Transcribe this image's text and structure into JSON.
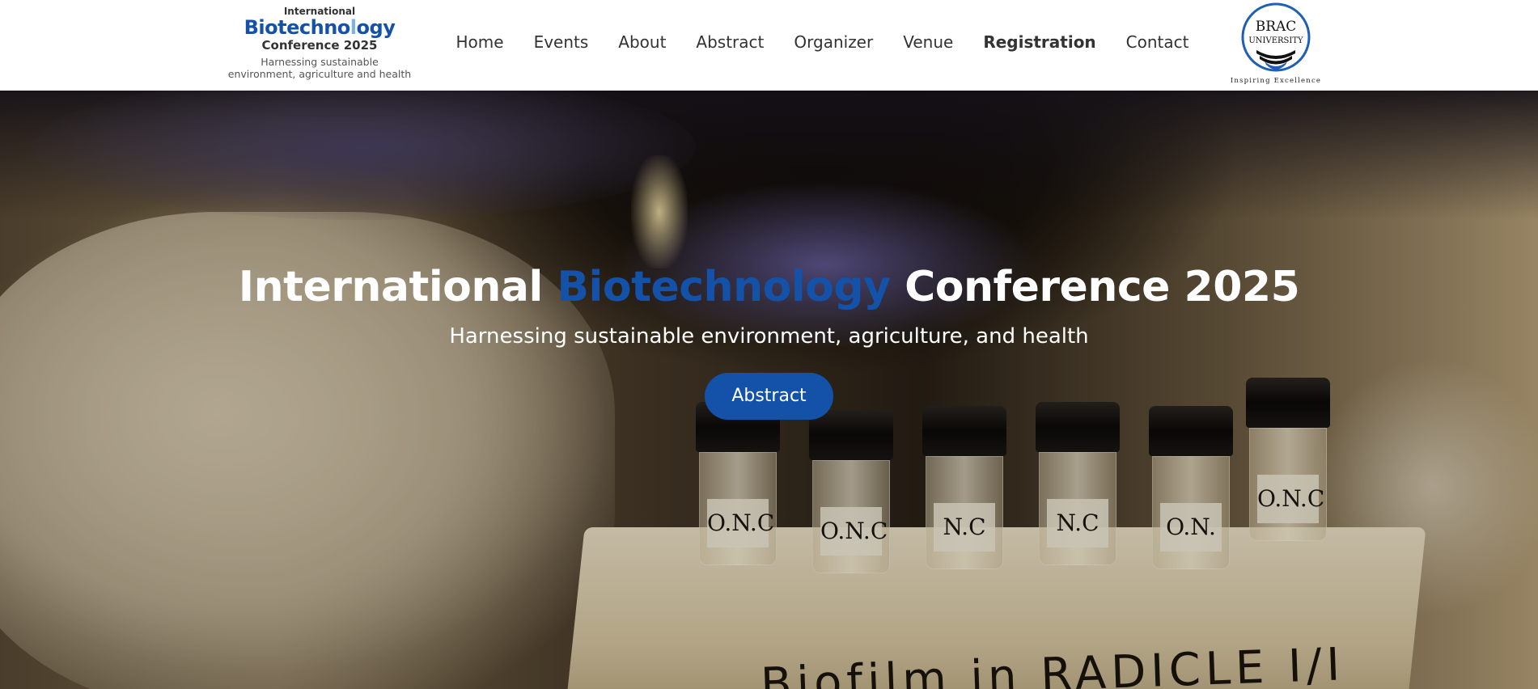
{
  "logo": {
    "top_line": "International",
    "main_before": "Biotechno",
    "main_helix": "l",
    "main_after": "ogy",
    "conference": "Conference 2025",
    "tagline_1": "Harnessing sustainable",
    "tagline_2": "environment, agriculture and health"
  },
  "nav": {
    "items": [
      {
        "label": "Home"
      },
      {
        "label": "Events"
      },
      {
        "label": "About"
      },
      {
        "label": "Abstract"
      },
      {
        "label": "Organizer"
      },
      {
        "label": "Venue"
      },
      {
        "label": "Registration"
      },
      {
        "label": "Contact"
      }
    ],
    "active": "Registration"
  },
  "partner_logo": {
    "name_line1": "BRAC",
    "name_line2": "UNIVERSITY",
    "tagline": "Inspiring Excellence"
  },
  "hero": {
    "title_before": "International ",
    "title_accent": "Biotechnology",
    "title_after": " Conference 2025",
    "subtitle": "Harnessing sustainable environment, agriculture, and health",
    "button_label": "Abstract",
    "photo_text": {
      "vial_labels": [
        "O.N.C",
        "O.N.C",
        "N.C",
        "N.C",
        "O.N.",
        "O.N.C"
      ],
      "foam_writing": "Biofilm in RADICLE I/I"
    }
  },
  "colors": {
    "brand_blue": "#1452a9",
    "nav_text": "#333333",
    "header_bg": "#ffffff"
  }
}
